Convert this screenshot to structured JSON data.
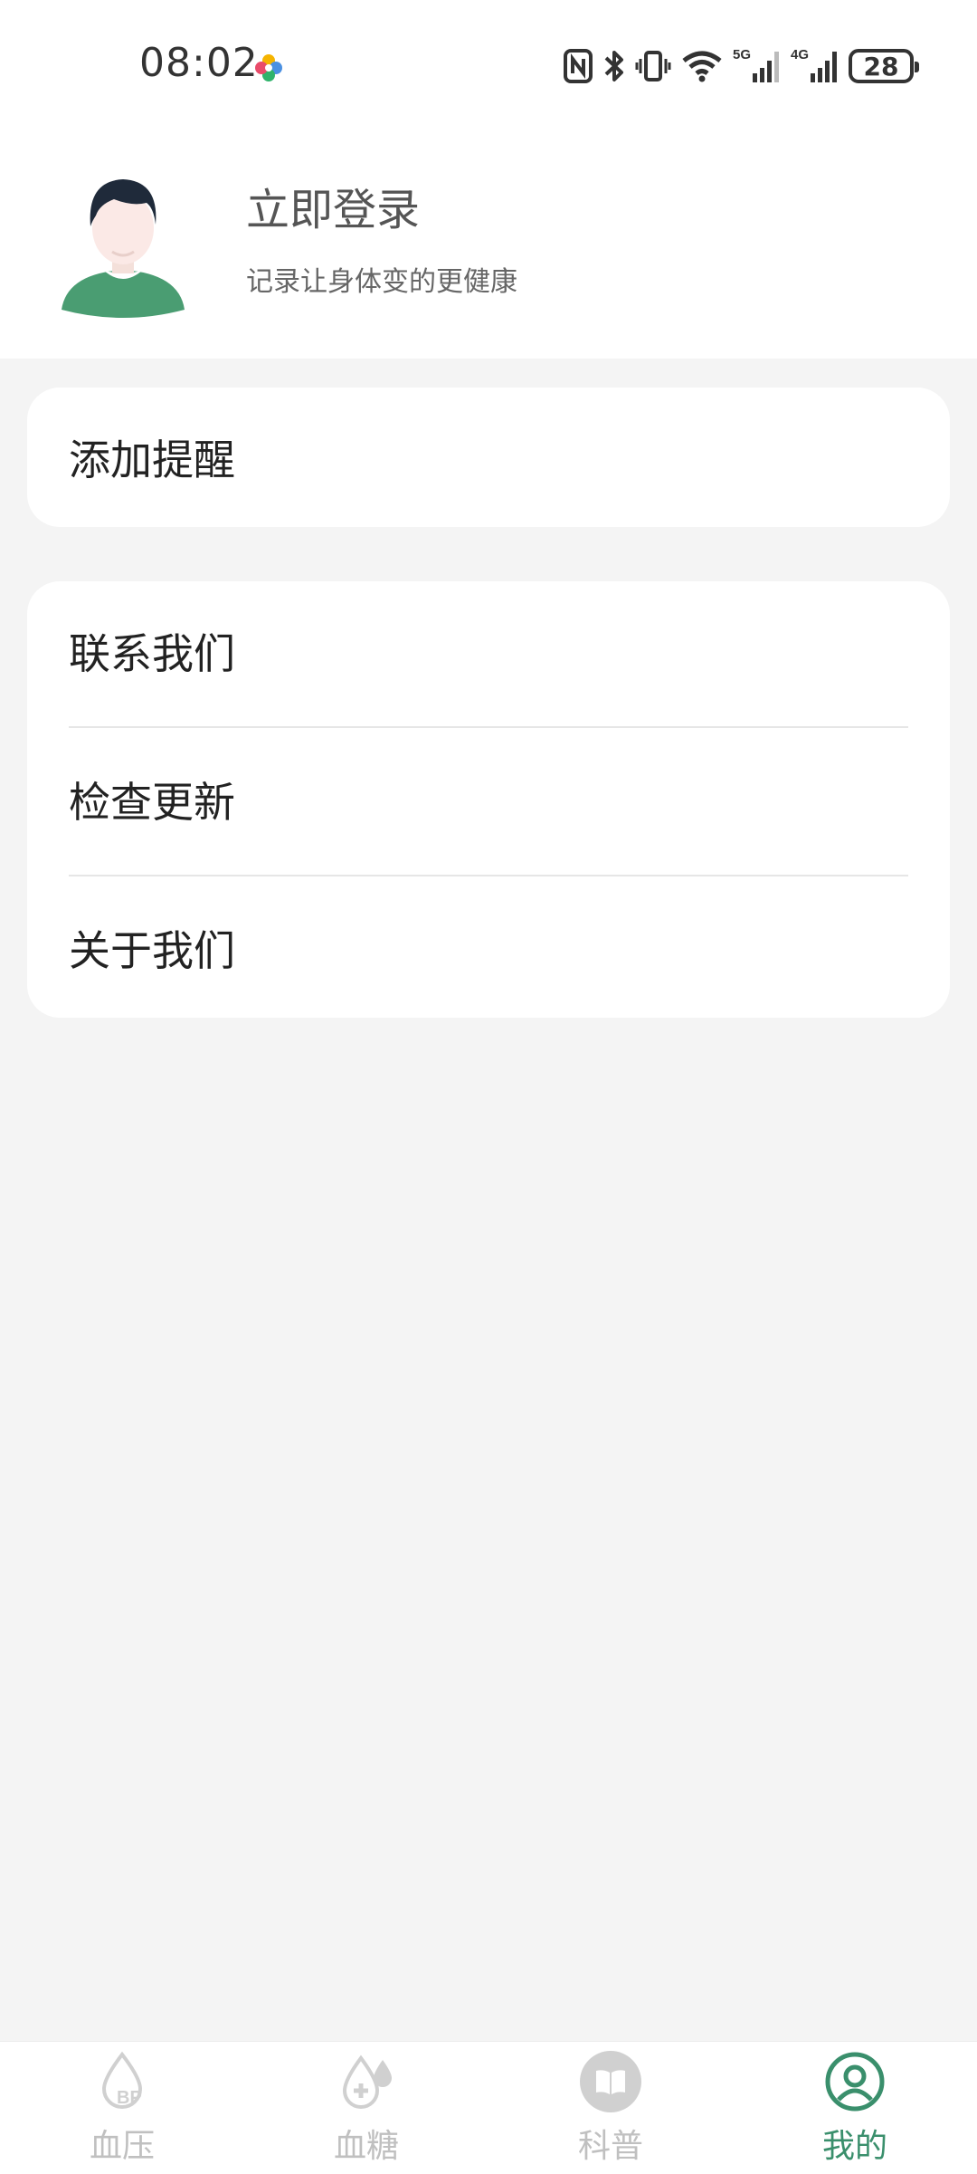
{
  "status_bar": {
    "time": "08:02",
    "battery": "28",
    "net1": "5G",
    "net2": "4G"
  },
  "profile": {
    "login_title": "立即登录",
    "subtitle": "记录让身体变的更健康"
  },
  "menu": {
    "add_reminder": "添加提醒",
    "items": [
      {
        "label": "联系我们"
      },
      {
        "label": "检查更新"
      },
      {
        "label": "关于我们"
      }
    ]
  },
  "nav": {
    "tabs": [
      {
        "label": "血压",
        "icon": "blood-pressure-icon",
        "active": false
      },
      {
        "label": "血糖",
        "icon": "blood-sugar-icon",
        "active": false
      },
      {
        "label": "科普",
        "icon": "book-icon",
        "active": false
      },
      {
        "label": "我的",
        "icon": "profile-icon",
        "active": true
      }
    ]
  },
  "colors": {
    "accent": "#3a8f6c",
    "inactive": "#c0c0c0",
    "background": "#f4f4f4",
    "avatar_shirt": "#4a9d72"
  }
}
